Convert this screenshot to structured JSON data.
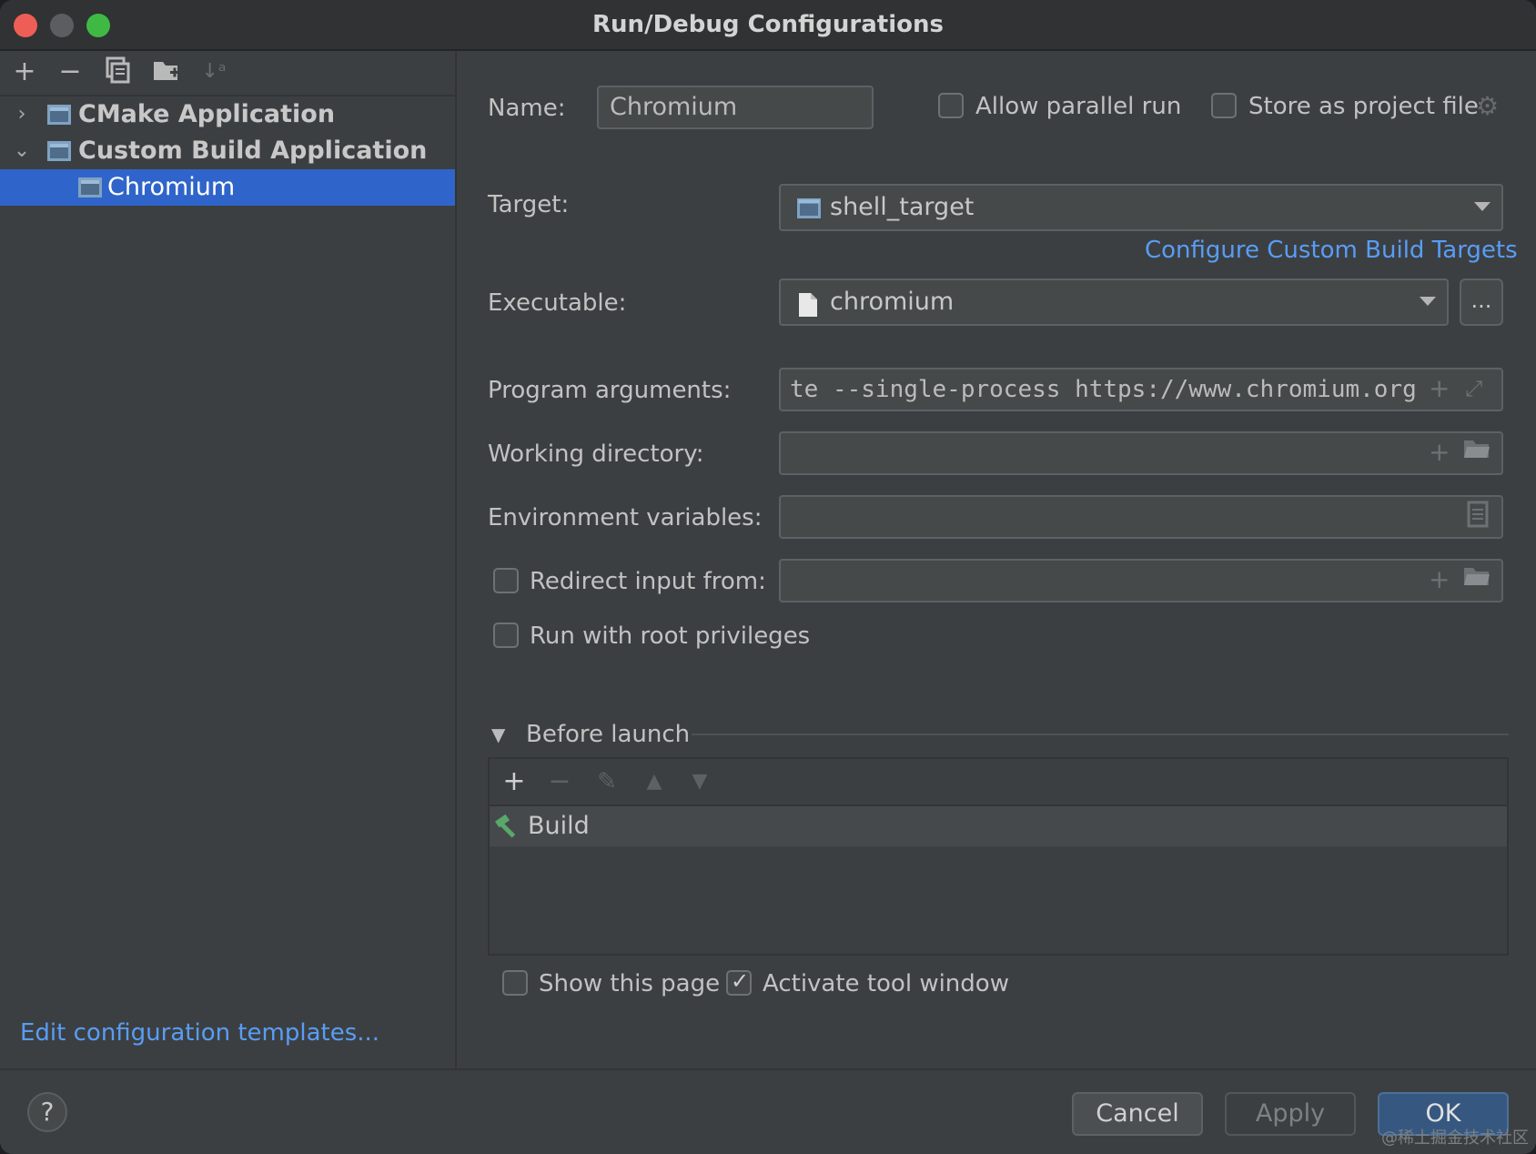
{
  "window": {
    "title": "Run/Debug Configurations"
  },
  "left_panel": {
    "toolbar": [
      {
        "name": "add-icon",
        "glyph": "+"
      },
      {
        "name": "remove-icon",
        "glyph": "−"
      },
      {
        "name": "copy-icon",
        "glyph": "⧉"
      },
      {
        "name": "folder-add-icon",
        "glyph": "▆"
      },
      {
        "name": "sort-icon",
        "glyph": "↓ᵃ"
      }
    ],
    "tree": [
      {
        "label": "CMake Application",
        "expanded": false
      },
      {
        "label": "Custom Build Application",
        "expanded": true
      },
      {
        "label": "Chromium",
        "selected": true
      }
    ],
    "edit_templates_link": "Edit configuration templates..."
  },
  "form": {
    "name_label": "Name:",
    "name_value": "Chromium",
    "allow_parallel_label": "Allow parallel run",
    "allow_parallel_checked": false,
    "store_project_label": "Store as project file",
    "store_project_checked": false,
    "target_label": "Target:",
    "target_value": "shell_target",
    "configure_link": "Configure Custom Build Targets",
    "executable_label": "Executable:",
    "executable_value": "chromium",
    "browse_label": "...",
    "program_args_label": "Program arguments:",
    "program_args_value": "te --single-process https://www.chromium.org",
    "working_dir_label": "Working directory:",
    "working_dir_value": "",
    "env_vars_label": "Environment variables:",
    "env_vars_value": "",
    "redirect_label": "Redirect input from:",
    "redirect_checked": false,
    "redirect_value": "",
    "root_label": "Run with root privileges",
    "root_checked": false
  },
  "before_launch": {
    "title": "Before launch",
    "tasks": [
      {
        "label": "Build"
      }
    ],
    "show_page_label": "Show this page",
    "show_page_checked": false,
    "activate_label": "Activate tool window",
    "activate_checked": true
  },
  "buttons": {
    "help": "?",
    "cancel": "Cancel",
    "apply": "Apply",
    "ok": "OK"
  },
  "watermark": "@稀土掘金技术社区",
  "colors": {
    "selection": "#2f65ca",
    "link": "#589df6",
    "ok_button": "#365880"
  }
}
